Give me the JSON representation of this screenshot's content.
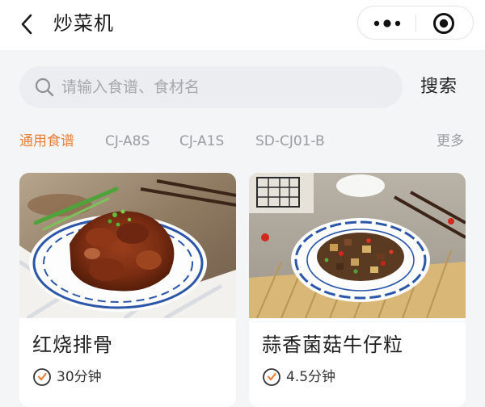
{
  "header": {
    "title": "炒菜机",
    "back_icon": "chevron-left-icon",
    "more_icon": "more-dots-icon",
    "close_icon": "target-circle-icon"
  },
  "search": {
    "placeholder": "请输入食谱、食材名",
    "button_label": "搜索"
  },
  "tabs": [
    {
      "label": "通用食谱",
      "active": true
    },
    {
      "label": "CJ-A8S",
      "active": false
    },
    {
      "label": "CJ-A1S",
      "active": false
    },
    {
      "label": "SD-CJ01-B",
      "active": false
    }
  ],
  "more_label": "更多",
  "recipes": [
    {
      "name": "红烧排骨",
      "time": "30分钟"
    },
    {
      "name": "蒜香菌菇牛仔粒",
      "time": "4.5分钟"
    }
  ],
  "colors": {
    "accent": "#e8803a",
    "clock_accent": "#e8803a",
    "background": "#f4f5f7",
    "search_bg": "#ebedf0",
    "tab_inactive": "#9a9ca1"
  }
}
